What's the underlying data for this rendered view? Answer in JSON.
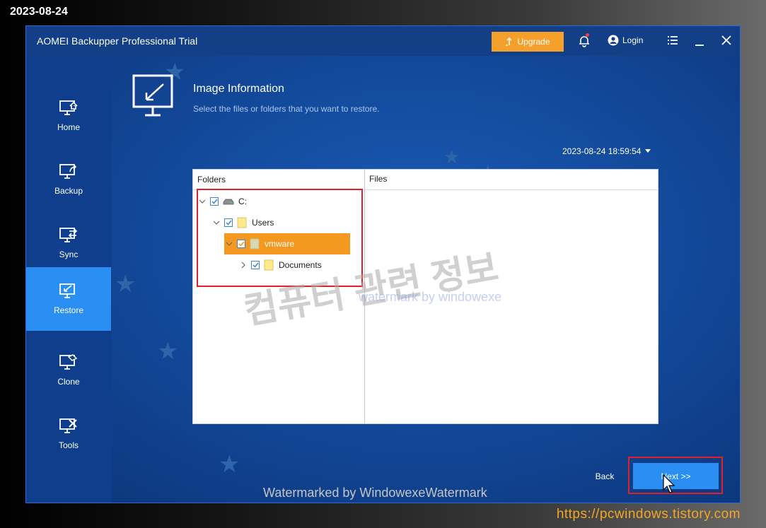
{
  "overlay": {
    "date_stamp": "2023-08-24",
    "site_url": "https://pcwindows.tistory.com"
  },
  "window": {
    "title": "AOMEI Backupper Professional Trial",
    "upgrade_label": "Upgrade",
    "login_label": "Login"
  },
  "sidebar": {
    "items": [
      {
        "label": "Home",
        "icon": "home-monitor-icon"
      },
      {
        "label": "Backup",
        "icon": "backup-monitor-icon"
      },
      {
        "label": "Sync",
        "icon": "sync-monitor-icon"
      },
      {
        "label": "Restore",
        "icon": "restore-monitor-icon",
        "active": true
      },
      {
        "label": "Clone",
        "icon": "clone-monitor-icon"
      },
      {
        "label": "Tools",
        "icon": "tools-monitor-icon"
      }
    ]
  },
  "main": {
    "title": "Image Information",
    "subtitle": "Select the files or folders that you want to restore.",
    "timestamp": "2023-08-24 18:59:54",
    "folders_header": "Folders",
    "files_header": "Files",
    "tree": [
      {
        "label": "C:",
        "checked": true,
        "expanded": true,
        "icon": "drive-icon"
      },
      {
        "label": "Users",
        "checked": true,
        "expanded": true,
        "icon": "folder-icon"
      },
      {
        "label": "vmware",
        "checked": true,
        "expanded": true,
        "icon": "folder-icon",
        "selected": true
      },
      {
        "label": "Documents",
        "checked": true,
        "expanded": false,
        "icon": "folder-icon"
      }
    ],
    "back_label": "Back",
    "next_label": "Next >>"
  },
  "watermarks": {
    "korean": "컴퓨터 관련 정보",
    "center": "watermark by windowexe",
    "bottom": "Watermarked by WindowexeWatermark"
  },
  "colors": {
    "accent": "#2a8ef3",
    "upgrade": "#f5a02a",
    "highlight": "#f5981f",
    "annotation": "#e0212b"
  }
}
